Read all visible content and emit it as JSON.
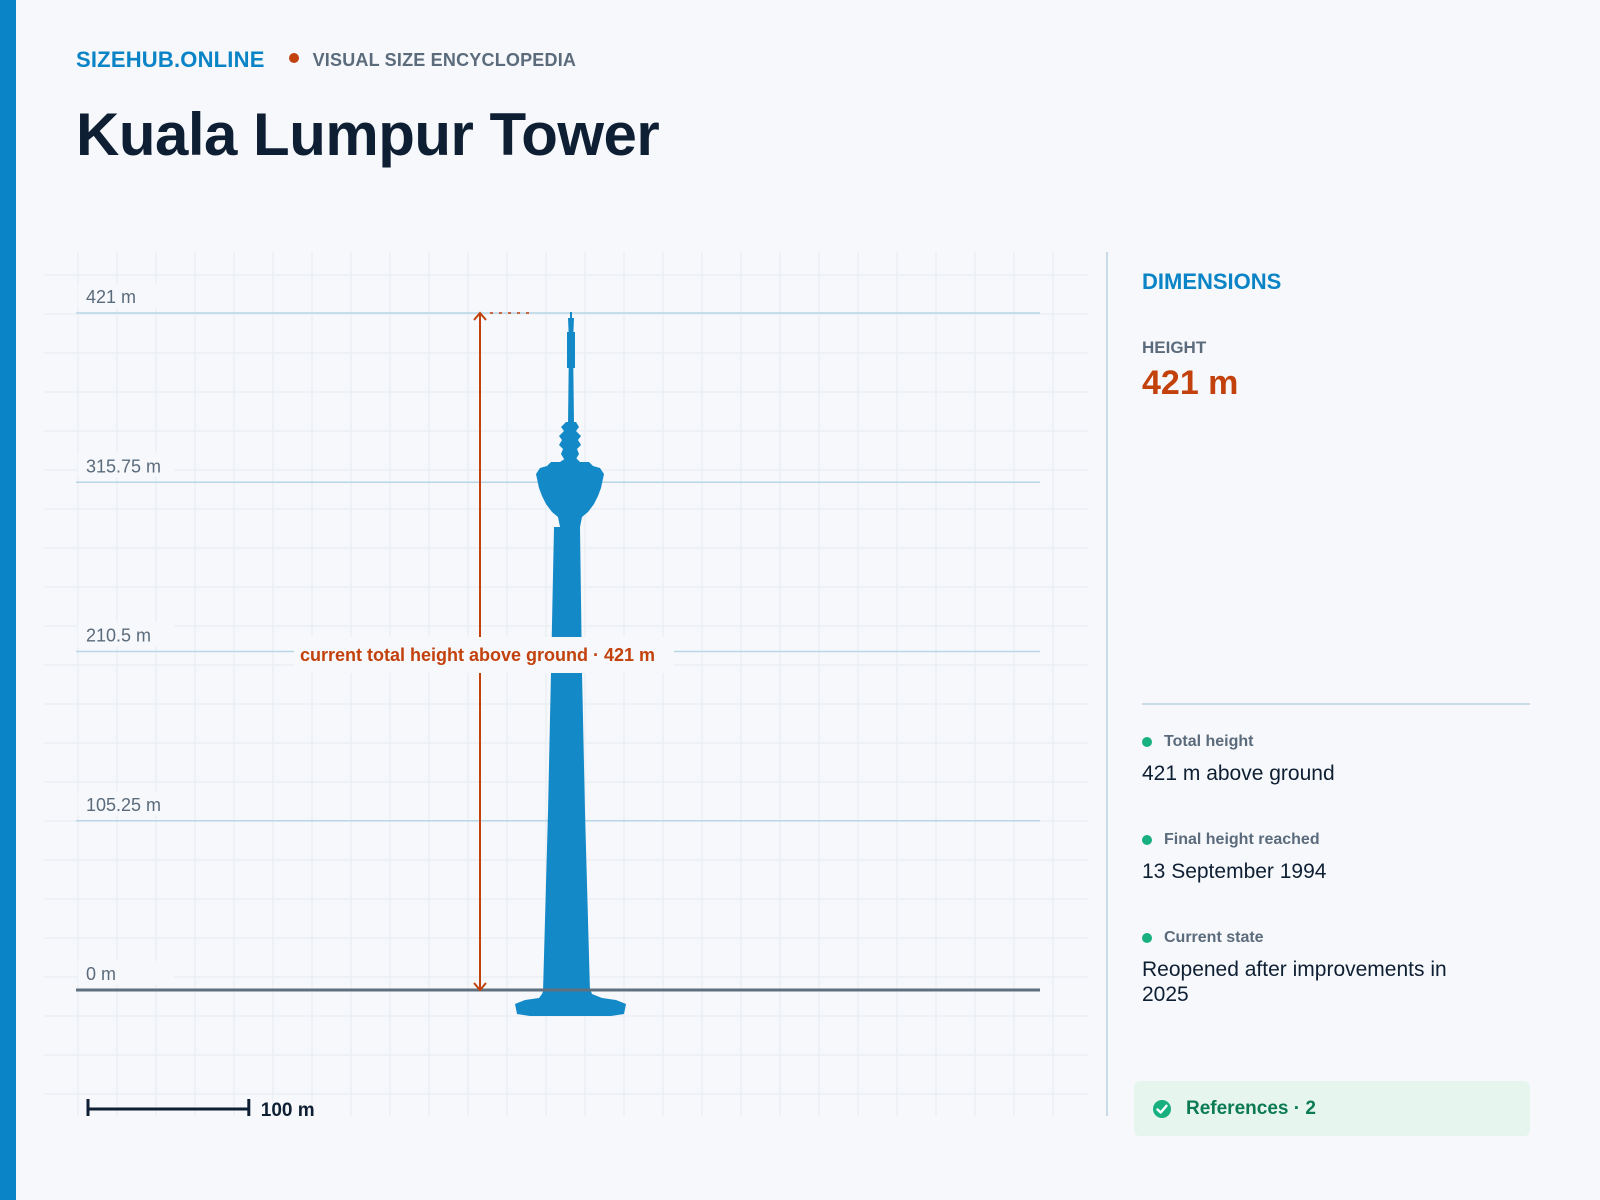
{
  "header": {
    "brand": "SIZEHUB.ONLINE",
    "subtitle": "VISUAL SIZE ENCYCLOPEDIA",
    "title": "Kuala Lumpur Tower"
  },
  "diagram": {
    "max_height_m": 421,
    "gridlines": [
      {
        "value": 421,
        "label": "421 m"
      },
      {
        "value": 315.75,
        "label": "315.75 m"
      },
      {
        "value": 210.5,
        "label": "210.5 m"
      },
      {
        "value": 105.25,
        "label": "105.25 m"
      },
      {
        "value": 0,
        "label": "0 m"
      }
    ],
    "annotation": "current total height above ground · 421 m",
    "scale_bar_value_m": 100,
    "scale_bar_label": "100 m",
    "colors": {
      "tower": "#1389c8",
      "measure": "#c2410c",
      "ground": "#5f7080",
      "gridline": "#b8d6e6",
      "scale_bar": "#0f1f33"
    }
  },
  "panel": {
    "section_title": "DIMENSIONS",
    "height_label": "HEIGHT",
    "height_value": "421 m",
    "facts": [
      {
        "label": "Total height",
        "value": "421 m above ground"
      },
      {
        "label": "Final height reached",
        "value": "13 September 1994"
      },
      {
        "label": "Current state",
        "value": "Reopened after improvements in 2025"
      }
    ],
    "references_label": "References · 2",
    "references_icon": "check-circle-icon"
  }
}
